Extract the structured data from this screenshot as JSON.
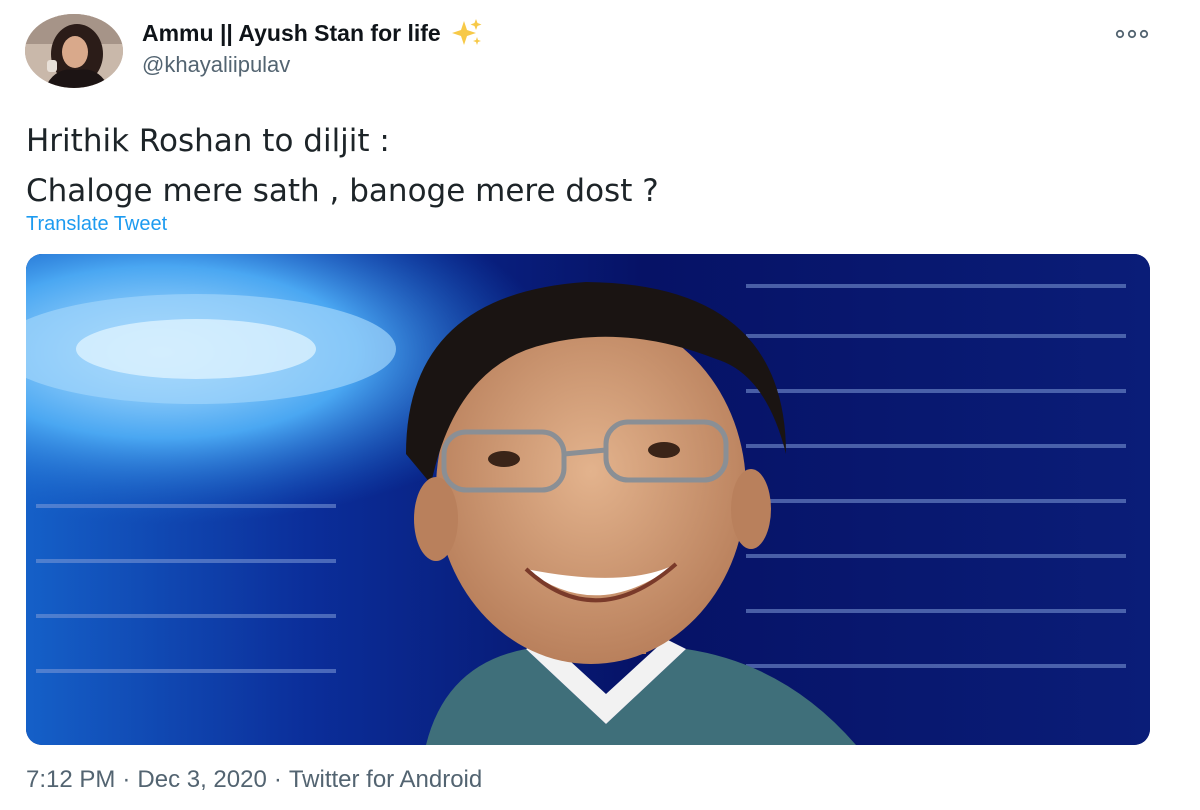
{
  "tweet": {
    "display_name": "Ammu || Ayush Stan for life",
    "handle": "@khayaliipulav",
    "text_line1": "Hrithik Roshan to diljit :",
    "text_line2": "Chaloge mere sath , banoge mere dost ?",
    "translate_label": "Translate Tweet",
    "time": "7:12 PM",
    "date": "Dec 3, 2020",
    "source": "Twitter for Android",
    "separator": "·"
  },
  "icons": {
    "name_emoji": "sparkles-icon",
    "more": "more-options-icon"
  },
  "colors": {
    "link": "#1d9bf0",
    "secondary_text": "#536471",
    "primary_text": "#0f1419"
  }
}
